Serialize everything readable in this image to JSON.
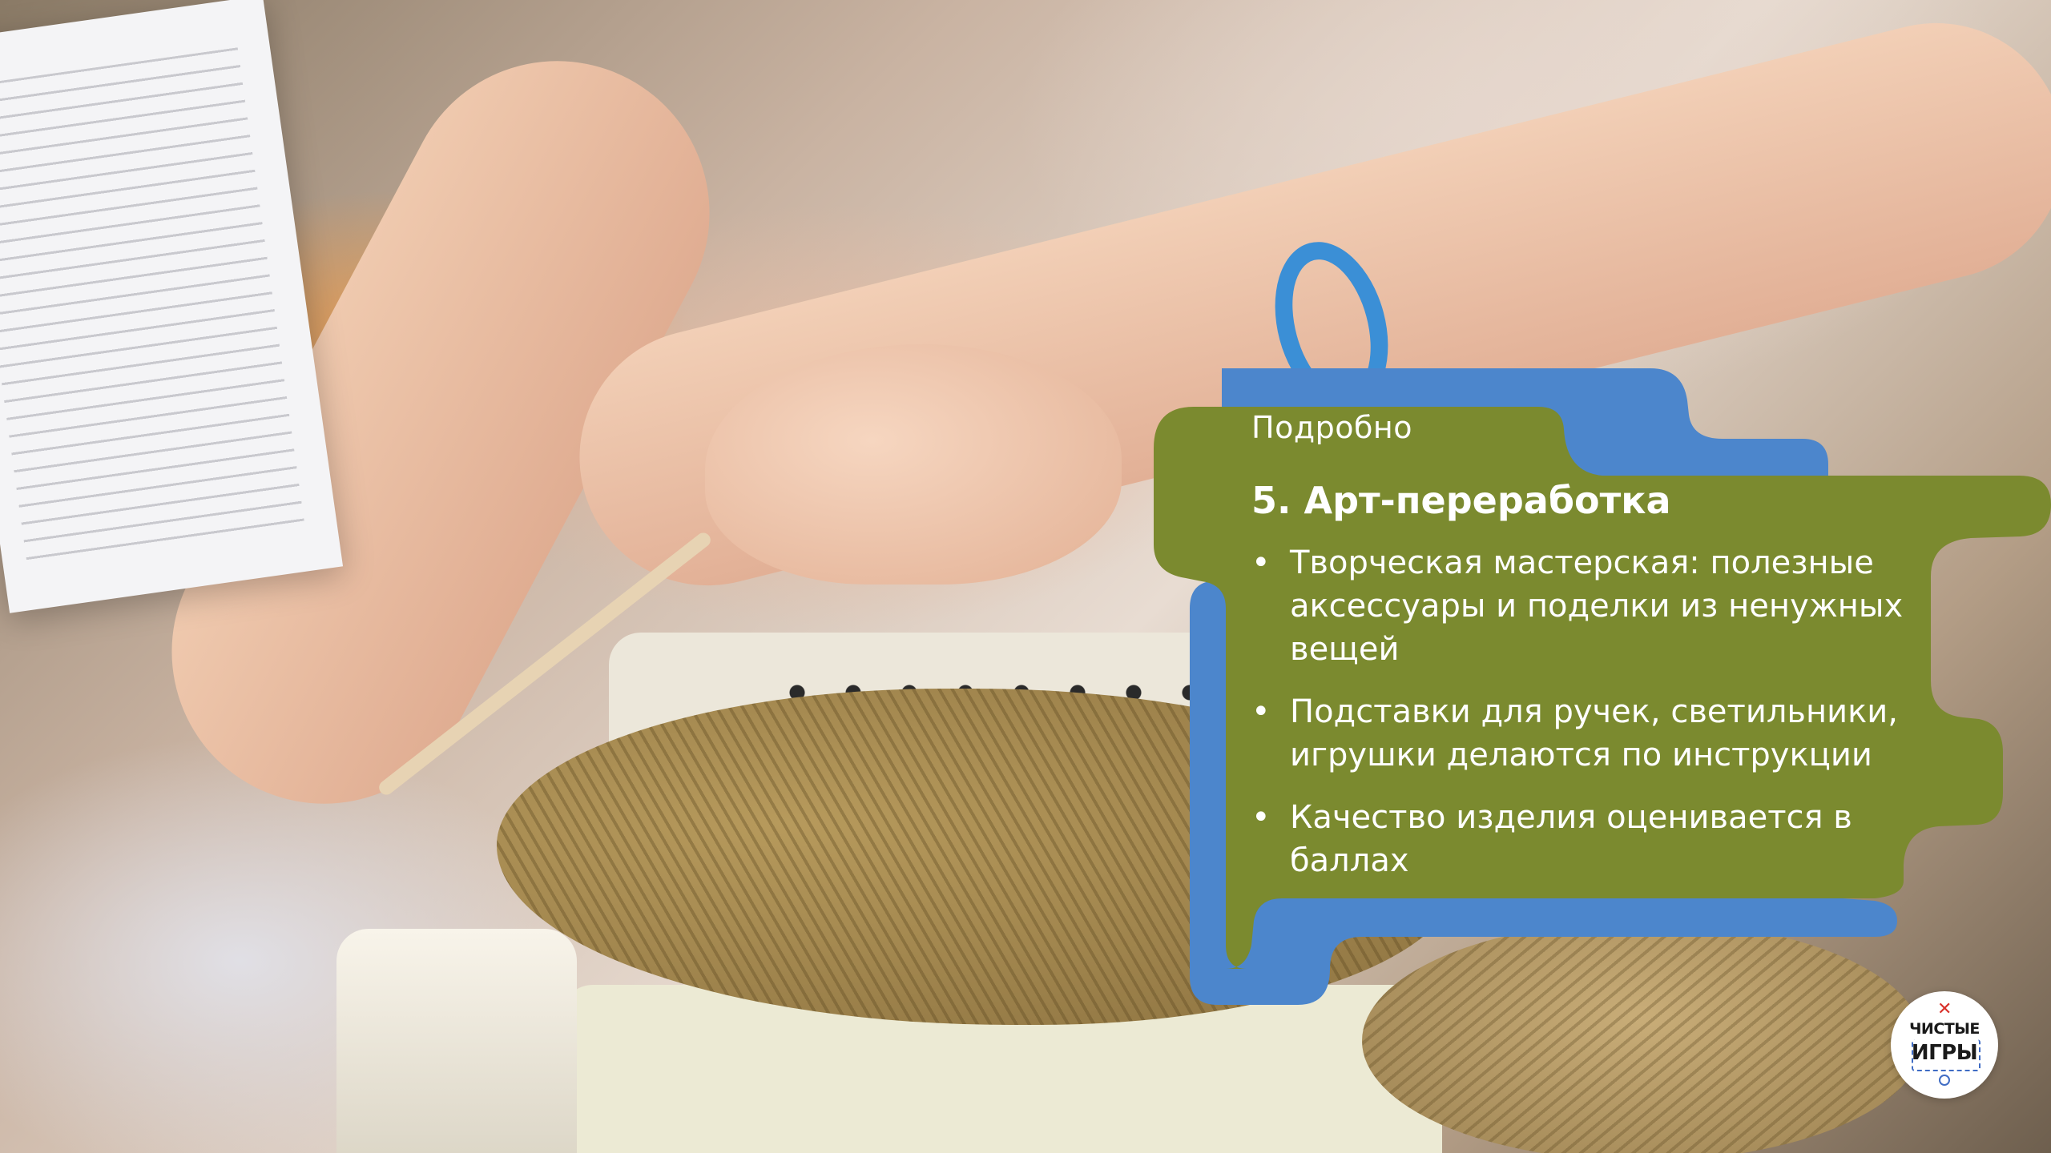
{
  "colors": {
    "card_green": "#7b8a2f",
    "card_blue": "#4c86cc",
    "text": "#ffffff",
    "logo_accent": "#d9322b",
    "logo_frame": "#3f6cc4"
  },
  "card": {
    "eyebrow": "Подробно",
    "title": "5. Арт-переработка",
    "bullet_glyph": "•",
    "bullets": [
      "Творческая мастерская: полезные аксессуары и поделки из ненужных вещей",
      "Подставки для ручек, светильники, игрушки делаются по инструкции",
      "Качество изделия оценивается в баллах"
    ]
  },
  "logo": {
    "mark": "✕",
    "line1": "ЧИСТЫЕ",
    "line2": "ИГРЫ"
  }
}
